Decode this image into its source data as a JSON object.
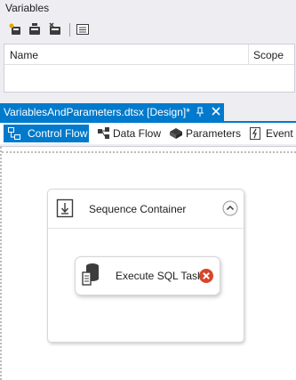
{
  "variables_panel": {
    "title": "Variables",
    "toolbar": [
      "add-variable-icon",
      "move-variable-icon",
      "delete-variable-icon",
      "grid-options-icon"
    ],
    "columns": {
      "name": "Name",
      "scope": "Scope"
    }
  },
  "document_tab": {
    "title": "VariablesAndParameters.dtsx [Design]*",
    "pin_glyph": "→",
    "close_glyph": "✕"
  },
  "designer_tabs": [
    {
      "label": "Control Flow",
      "icon": "control-flow-icon",
      "selected": true
    },
    {
      "label": "Data Flow",
      "icon": "data-flow-icon",
      "selected": false
    },
    {
      "label": "Parameters",
      "icon": "parameters-icon",
      "selected": false
    },
    {
      "label": "Event H",
      "icon": "event-handlers-icon",
      "selected": false
    }
  ],
  "canvas": {
    "sequence_container": {
      "title": "Sequence Container",
      "icon": "sequence-container-icon",
      "collapse_icon": "chevron-up-icon"
    },
    "task": {
      "label": "Execute SQL Task",
      "icon": "execute-sql-icon",
      "status_icon": "error-icon",
      "status_color": "#d9452a"
    }
  },
  "colors": {
    "accent": "#007acc",
    "background": "#eeeef2"
  }
}
